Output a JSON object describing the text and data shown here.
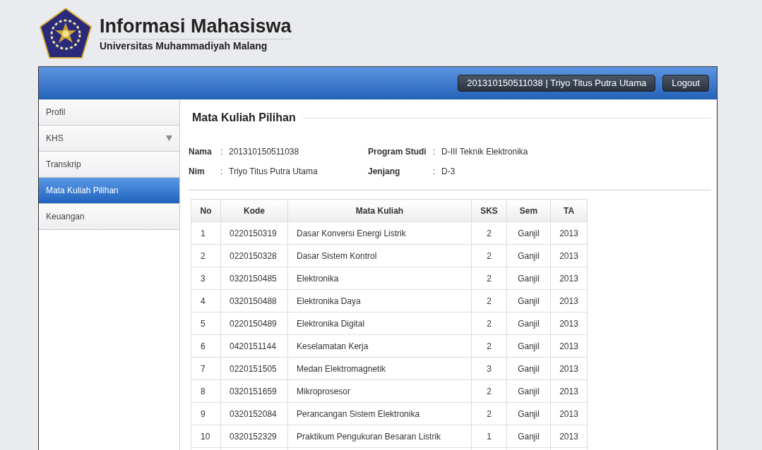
{
  "header": {
    "title": "Informasi Mahasiswa",
    "subtitle": "Universitas Muhammadiyah Malang"
  },
  "top_bar": {
    "user": "201310150511038 | Triyo Titus Putra Utama",
    "logout": "Logout"
  },
  "sidebar": {
    "items": [
      {
        "label": "Profil",
        "selected": false,
        "has_submenu": false
      },
      {
        "label": "KHS",
        "selected": false,
        "has_submenu": true
      },
      {
        "label": "Transkrip",
        "selected": false,
        "has_submenu": false
      },
      {
        "label": "Mata Kuliah Pilihan",
        "selected": true,
        "has_submenu": false
      },
      {
        "label": "Keuangan",
        "selected": false,
        "has_submenu": false
      }
    ]
  },
  "content": {
    "title": "Mata Kuliah Pilihan",
    "info": [
      {
        "label": "Nama",
        "value": "201310150511038"
      },
      {
        "label": "Program Studi",
        "value": "D-III Teknik Elektronika"
      },
      {
        "label": "Nim",
        "value": "Triyo Titus Putra Utama"
      },
      {
        "label": "Jenjang",
        "value": "D-3"
      }
    ],
    "separator": ":",
    "table": {
      "columns": [
        "No",
        "Kode",
        "Mata Kuliah",
        "SKS",
        "Sem",
        "TA"
      ],
      "rows": [
        [
          "1",
          "0220150319",
          "Dasar Konversi Energi Listrik",
          "2",
          "Ganjil",
          "2013"
        ],
        [
          "2",
          "0220150328",
          "Dasar Sistem Kontrol",
          "2",
          "Ganjil",
          "2013"
        ],
        [
          "3",
          "0320150485",
          "Elektronika",
          "2",
          "Ganjil",
          "2013"
        ],
        [
          "4",
          "0320150488",
          "Elektronika Daya",
          "2",
          "Ganjil",
          "2013"
        ],
        [
          "5",
          "0220150489",
          "Elektronika Digital",
          "2",
          "Ganjil",
          "2013"
        ],
        [
          "6",
          "0420151144",
          "Keselamatan Kerja",
          "2",
          "Ganjil",
          "2013"
        ],
        [
          "7",
          "0220151505",
          "Medan Elektromagnetik",
          "3",
          "Ganjil",
          "2013"
        ],
        [
          "8",
          "0320151659",
          "Mikroprosesor",
          "2",
          "Ganjil",
          "2013"
        ],
        [
          "9",
          "0320152084",
          "Perancangan Sistem Elektronika",
          "2",
          "Ganjil",
          "2013"
        ],
        [
          "10",
          "0320152329",
          "Praktikum Pengukuran Besaran Listrik",
          "1",
          "Ganjil",
          "2013"
        ]
      ]
    }
  }
}
